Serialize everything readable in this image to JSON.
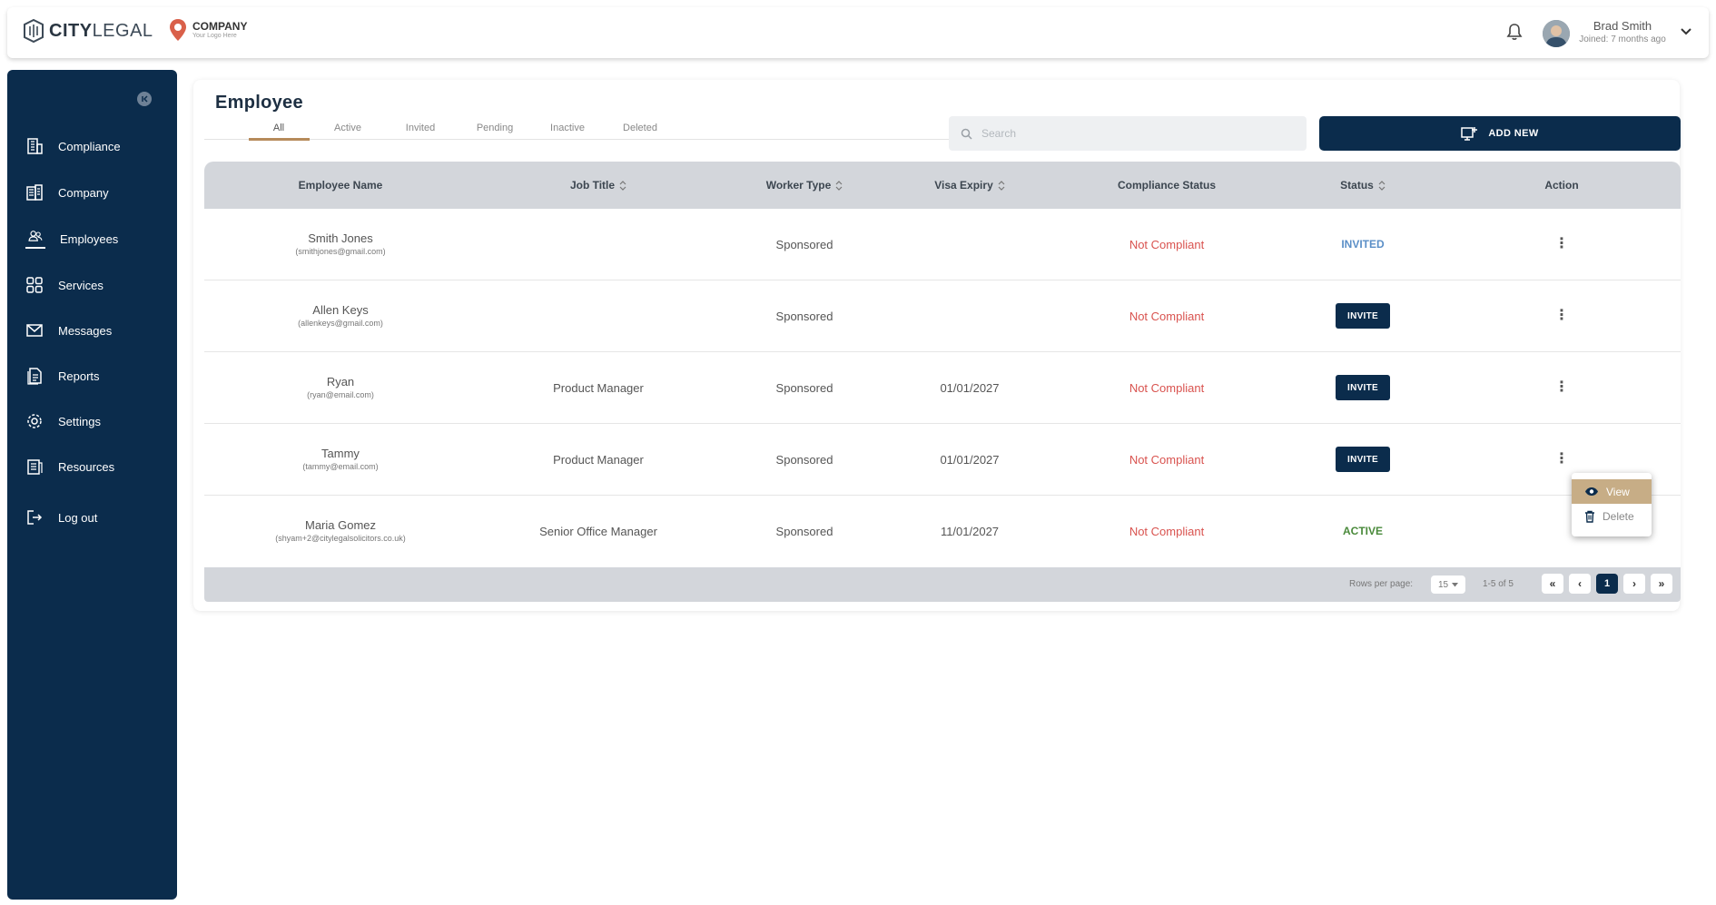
{
  "header": {
    "brand_part1": "CITY",
    "brand_part2": "LEGAL",
    "company_name": "COMPANY",
    "company_sub": "Your Logo Here",
    "user_name": "Brad Smith",
    "user_joined": "Joined: 7 months ago",
    "icons": [
      "bell-icon",
      "chevron-down-icon"
    ]
  },
  "sidebar": {
    "items": [
      {
        "label": "Compliance",
        "icon": "building-icon"
      },
      {
        "label": "Company",
        "icon": "office-icon"
      },
      {
        "label": "Employees",
        "icon": "people-icon"
      },
      {
        "label": "Services",
        "icon": "grid-icon"
      },
      {
        "label": "Messages",
        "icon": "mail-icon"
      },
      {
        "label": "Reports",
        "icon": "document-icon"
      },
      {
        "label": "Settings",
        "icon": "gear-icon"
      },
      {
        "label": "Resources",
        "icon": "book-icon"
      },
      {
        "label": "Log out",
        "icon": "logout-icon"
      }
    ],
    "active": "Employees"
  },
  "main": {
    "title": "Employee",
    "tabs": [
      "All",
      "Active",
      "Invited",
      "Pending",
      "Inactive",
      "Deleted"
    ],
    "active_tab": "All",
    "search_placeholder": "Search",
    "add_label": "ADD NEW",
    "columns": [
      "Employee Name",
      "Job Title",
      "Worker Type",
      "Visa Expiry",
      "Compliance Status",
      "Status",
      "Action"
    ],
    "rows": [
      {
        "name": "Smith Jones",
        "email": "(smithjones@gmail.com)",
        "job": "",
        "worker": "Sponsored",
        "visa": "",
        "compliance": "Not Compliant",
        "status": "INVITED"
      },
      {
        "name": "Allen Keys",
        "email": "(allenkeys@gmail.com)",
        "job": "",
        "worker": "Sponsored",
        "visa": "",
        "compliance": "Not Compliant",
        "status": "INVITE"
      },
      {
        "name": "Ryan",
        "email": "(ryan@email.com)",
        "job": "Product Manager",
        "worker": "Sponsored",
        "visa": "01/01/2027",
        "compliance": "Not Compliant",
        "status": "INVITE"
      },
      {
        "name": "Tammy",
        "email": "(tammy@email.com)",
        "job": "Product Manager",
        "worker": "Sponsored",
        "visa": "01/01/2027",
        "compliance": "Not Compliant",
        "status": "INVITE"
      },
      {
        "name": "Maria Gomez",
        "email": "(shyam+2@citylegalsolicitors.co.uk)",
        "job": "Senior Office Manager",
        "worker": "Sponsored",
        "visa": "11/01/2027",
        "compliance": "Not Compliant",
        "status": "ACTIVE"
      }
    ],
    "pagination": {
      "rows_per_page_label": "Rows per page:",
      "rows_per_page": "15",
      "range": "1-5 of 5",
      "current_page": "1"
    },
    "action_menu": {
      "view": "View",
      "delete": "Delete"
    }
  },
  "colors": {
    "primary": "#0b2c4c",
    "accent": "#b68a5a",
    "not_compliant": "#d9534f",
    "invited": "#5b8fc7",
    "active": "#4a8a3b"
  }
}
